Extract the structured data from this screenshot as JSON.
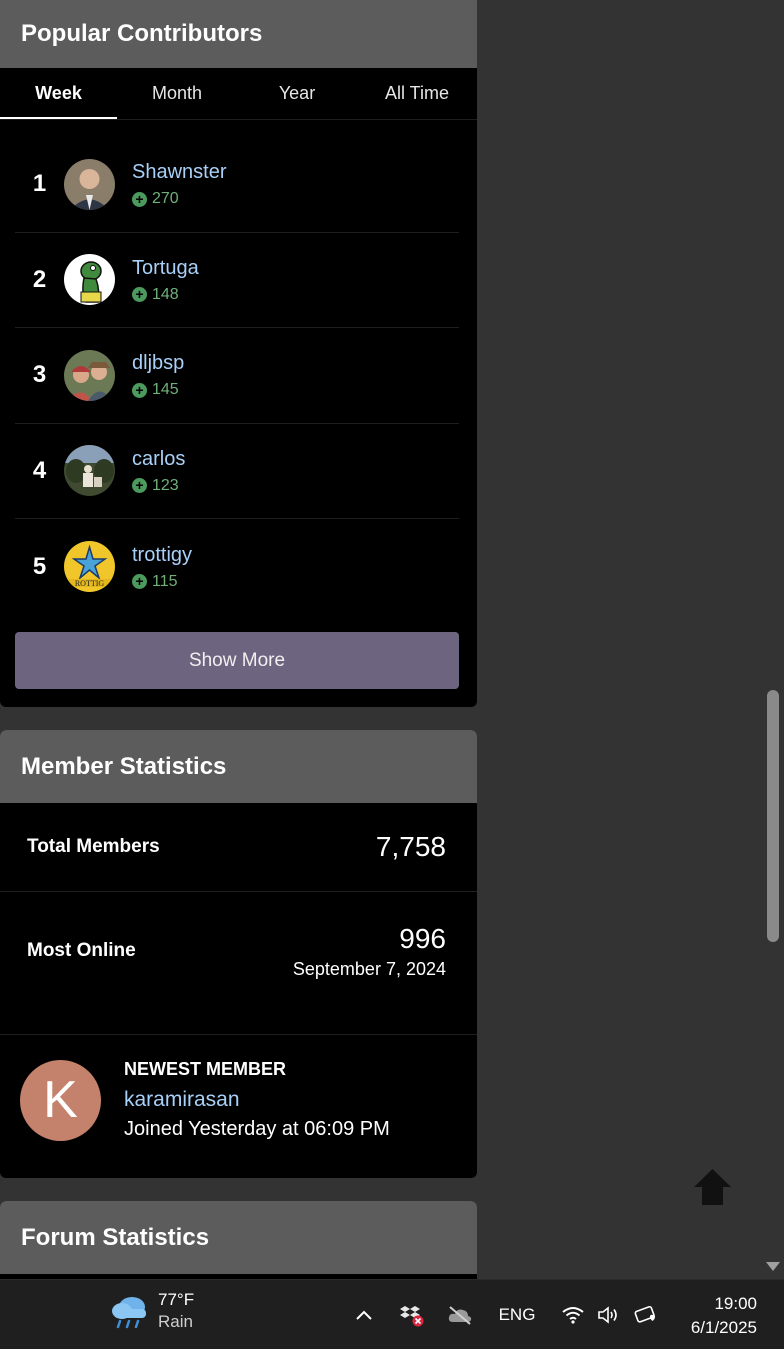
{
  "contributors": {
    "title": "Popular Contributors",
    "tabs": [
      {
        "label": "Week",
        "active": true
      },
      {
        "label": "Month",
        "active": false
      },
      {
        "label": "Year",
        "active": false
      },
      {
        "label": "All Time",
        "active": false
      }
    ],
    "rows": [
      {
        "rank": "1",
        "name": "Shawnster",
        "score": "270"
      },
      {
        "rank": "2",
        "name": "Tortuga",
        "score": "148"
      },
      {
        "rank": "3",
        "name": "dljbsp",
        "score": "145"
      },
      {
        "rank": "4",
        "name": "carlos",
        "score": "123"
      },
      {
        "rank": "5",
        "name": "trottigy",
        "score": "115"
      }
    ],
    "show_more": "Show More"
  },
  "member_stats": {
    "title": "Member Statistics",
    "total_label": "Total Members",
    "total_value": "7,758",
    "online_label": "Most Online",
    "online_value": "996",
    "online_date": "September 7, 2024",
    "newest_title": "NEWEST MEMBER",
    "newest_initial": "K",
    "newest_name": "karamirasan",
    "newest_joined": "Joined Yesterday at 06:09 PM"
  },
  "forum_stats": {
    "title": "Forum Statistics"
  },
  "taskbar": {
    "temp": "77°F",
    "condition": "Rain",
    "language": "ENG",
    "time": "19:00",
    "date": "6/1/2025"
  },
  "colors": {
    "link": "#a8d0f8",
    "score_green": "#6fb07a",
    "button": "#6d6580",
    "avatar_k": "#c4826c"
  }
}
